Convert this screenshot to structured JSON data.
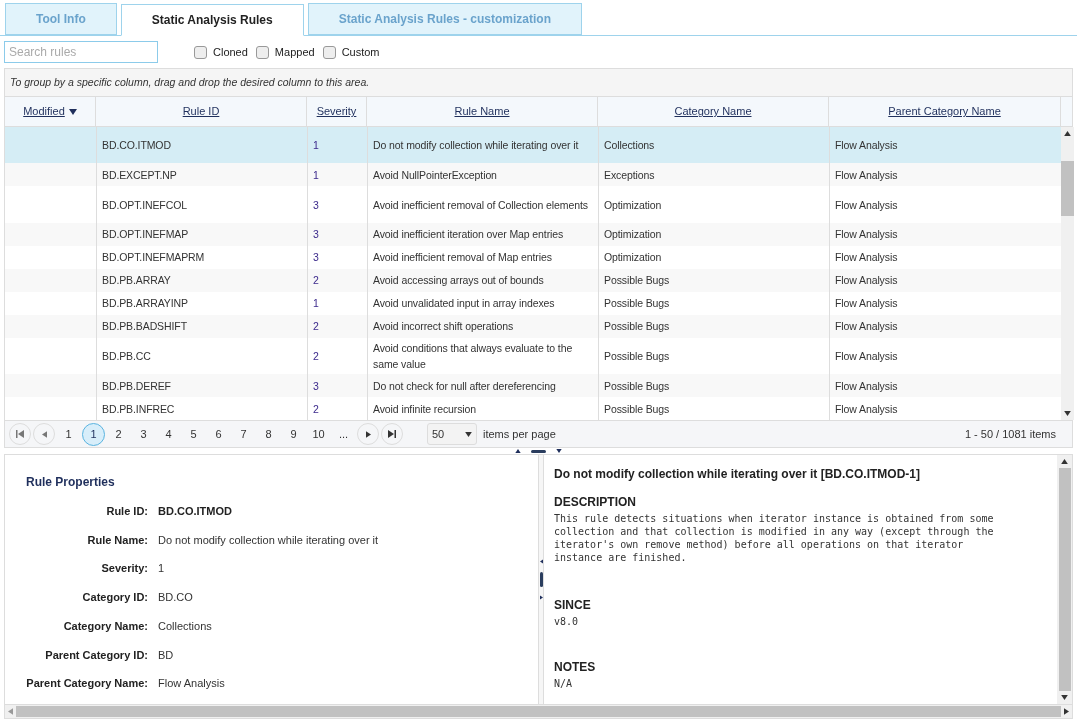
{
  "tabs": [
    {
      "label": "Tool Info",
      "selected": false
    },
    {
      "label": "Static Analysis Rules",
      "selected": true
    },
    {
      "label": "Static Analysis Rules - customization",
      "selected": false
    }
  ],
  "search": {
    "placeholder": "Search rules"
  },
  "filters": [
    {
      "label": "Cloned",
      "checked": false
    },
    {
      "label": "Mapped",
      "checked": false
    },
    {
      "label": "Custom",
      "checked": false
    }
  ],
  "group_hint": "To group by a specific column, drag and drop the desired column to this area.",
  "table": {
    "columns": [
      {
        "label": "Modified",
        "sorted": true
      },
      {
        "label": "Rule ID",
        "sorted": false
      },
      {
        "label": "Severity",
        "sorted": false
      },
      {
        "label": "Rule Name",
        "sorted": false
      },
      {
        "label": "Category Name",
        "sorted": false
      },
      {
        "label": "Parent Category Name",
        "sorted": false
      }
    ],
    "rows": [
      {
        "selected": true,
        "cells": [
          "",
          "BD.CO.ITMOD",
          "1",
          "Do not modify collection while iterating over it",
          "Collections",
          "Flow Analysis"
        ]
      },
      {
        "selected": false,
        "cells": [
          "",
          "BD.EXCEPT.NP",
          "1",
          "Avoid NullPointerException",
          "Exceptions",
          "Flow Analysis"
        ]
      },
      {
        "selected": false,
        "cells": [
          "",
          "BD.OPT.INEFCOL",
          "3",
          "Avoid inefficient removal of Collection elements",
          "Optimization",
          "Flow Analysis"
        ]
      },
      {
        "selected": false,
        "cells": [
          "",
          "BD.OPT.INEFMAP",
          "3",
          "Avoid inefficient iteration over Map entries",
          "Optimization",
          "Flow Analysis"
        ]
      },
      {
        "selected": false,
        "cells": [
          "",
          "BD.OPT.INEFMAPRM",
          "3",
          "Avoid inefficient removal of Map entries",
          "Optimization",
          "Flow Analysis"
        ]
      },
      {
        "selected": false,
        "cells": [
          "",
          "BD.PB.ARRAY",
          "2",
          "Avoid accessing arrays out of bounds",
          "Possible Bugs",
          "Flow Analysis"
        ]
      },
      {
        "selected": false,
        "cells": [
          "",
          "BD.PB.ARRAYINP",
          "1",
          "Avoid unvalidated input in array indexes",
          "Possible Bugs",
          "Flow Analysis"
        ]
      },
      {
        "selected": false,
        "cells": [
          "",
          "BD.PB.BADSHIFT",
          "2",
          "Avoid incorrect shift operations",
          "Possible Bugs",
          "Flow Analysis"
        ]
      },
      {
        "selected": false,
        "cells": [
          "",
          "BD.PB.CC",
          "2",
          "Avoid conditions that always evaluate to the same value",
          "Possible Bugs",
          "Flow Analysis"
        ]
      },
      {
        "selected": false,
        "cells": [
          "",
          "BD.PB.DEREF",
          "3",
          "Do not check for null after dereferencing",
          "Possible Bugs",
          "Flow Analysis"
        ]
      },
      {
        "selected": false,
        "cells": [
          "",
          "BD.PB.INFREC",
          "2",
          "Avoid infinite recursion",
          "Possible Bugs",
          "Flow Analysis"
        ]
      }
    ]
  },
  "pager": {
    "pages": [
      {
        "label": "1",
        "selected": false
      },
      {
        "label": "1",
        "selected": true
      },
      {
        "label": "2",
        "selected": false
      },
      {
        "label": "3",
        "selected": false
      },
      {
        "label": "4",
        "selected": false
      },
      {
        "label": "5",
        "selected": false
      },
      {
        "label": "6",
        "selected": false
      },
      {
        "label": "7",
        "selected": false
      },
      {
        "label": "8",
        "selected": false
      },
      {
        "label": "9",
        "selected": false
      },
      {
        "label": "10",
        "selected": false
      },
      {
        "label": "...",
        "selected": false
      }
    ],
    "page_size": "50",
    "page_size_label": "items per page",
    "summary": "1 - 50 / 1081 items"
  },
  "properties": {
    "title": "Rule Properties",
    "fields": [
      {
        "label": "Rule ID:",
        "value": "BD.CO.ITMOD",
        "bold": true
      },
      {
        "label": "Rule Name:",
        "value": "Do not modify collection while iterating over it",
        "bold": false
      },
      {
        "label": "Severity:",
        "value": "1",
        "bold": false
      },
      {
        "label": "Category ID:",
        "value": "BD.CO",
        "bold": false
      },
      {
        "label": "Category Name:",
        "value": "Collections",
        "bold": false
      },
      {
        "label": "Parent Category ID:",
        "value": "BD",
        "bold": false
      },
      {
        "label": "Parent Category Name:",
        "value": "Flow Analysis",
        "bold": false
      }
    ]
  },
  "doc": {
    "title": "Do not modify collection while iterating over it [BD.CO.ITMOD-1]",
    "sections": [
      {
        "heading": "DESCRIPTION",
        "text": "This rule detects situations when iterator instance is obtained from some collection and that collection is modified in any way (except through the iterator's own remove method) before all operations on that iterator instance are finished."
      },
      {
        "heading": "SINCE",
        "text": "v8.0"
      },
      {
        "heading": "NOTES",
        "text": "N/A"
      }
    ]
  }
}
